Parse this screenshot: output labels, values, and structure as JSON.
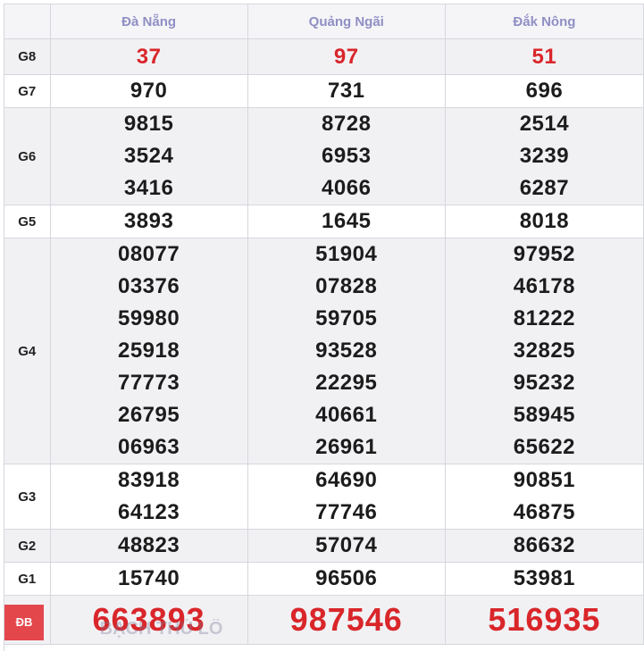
{
  "provinces": [
    "Đà Nẵng",
    "Quảng Ngãi",
    "Đắk Nông"
  ],
  "labels": {
    "g8": "G8",
    "g7": "G7",
    "g6": "G6",
    "g5": "G5",
    "g4": "G4",
    "g3": "G3",
    "g2": "G2",
    "g1": "G1",
    "db": "ĐB"
  },
  "prizes": {
    "g8": [
      "37",
      "97",
      "51"
    ],
    "g7": [
      "970",
      "731",
      "696"
    ],
    "g6": [
      [
        "9815",
        "3524",
        "3416"
      ],
      [
        "8728",
        "6953",
        "4066"
      ],
      [
        "2514",
        "3239",
        "6287"
      ]
    ],
    "g5": [
      "3893",
      "1645",
      "8018"
    ],
    "g4": [
      [
        "08077",
        "03376",
        "59980",
        "25918",
        "77773",
        "26795",
        "06963"
      ],
      [
        "51904",
        "07828",
        "59705",
        "93528",
        "22295",
        "40661",
        "26961"
      ],
      [
        "97952",
        "46178",
        "81222",
        "32825",
        "95232",
        "58945",
        "65622"
      ]
    ],
    "g3": [
      [
        "83918",
        "64123"
      ],
      [
        "64690",
        "77746"
      ],
      [
        "90851",
        "46875"
      ]
    ],
    "g2": [
      "48823",
      "57074",
      "86632"
    ],
    "g1": [
      "15740",
      "96506",
      "53981"
    ],
    "db": [
      "663893",
      "987546",
      "516935"
    ]
  },
  "watermark": "BẠCH THỦ LÔ",
  "colors": {
    "header_text": "#8f8fc4",
    "special_red": "#d9262a",
    "badge_red": "#e4474b",
    "shade": "#f1f1f4"
  }
}
